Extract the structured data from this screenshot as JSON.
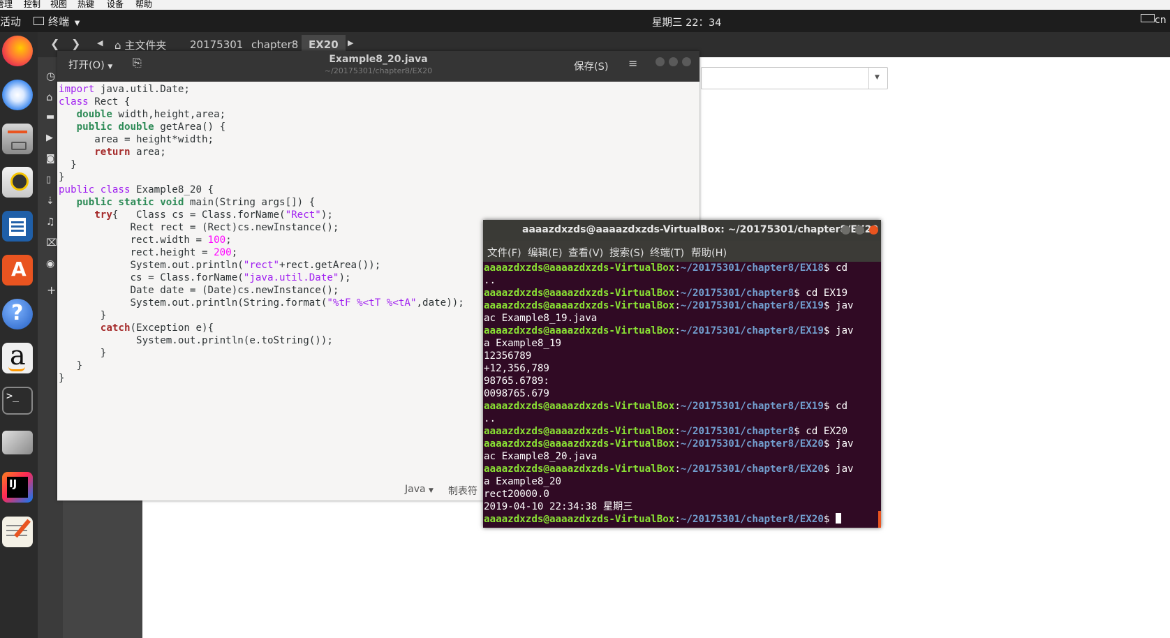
{
  "vbox_menu": [
    "管理",
    "控制",
    "视图",
    "热键",
    "设备",
    "帮助"
  ],
  "topbar": {
    "activities": "活动",
    "app_menu": "终端",
    "clock": "星期三 22：34",
    "input_method": "cn"
  },
  "files": {
    "breadcrumbs": [
      "主文件夹",
      "20175301",
      "chapter8",
      "EX20"
    ]
  },
  "gedit": {
    "open_label": "打开(O)",
    "filename": "Example8_20.java",
    "path": "~/20175301/chapter8/EX20",
    "save_label": "保存(S)",
    "language": "Java",
    "tab_width": "制表符"
  },
  "code_lines": [
    [
      [
        "import",
        "kw-p"
      ],
      [
        " java.util.Date;",
        ""
      ]
    ],
    [
      [
        "class",
        "kw-p"
      ],
      [
        " Rect {",
        ""
      ]
    ],
    [
      [
        "   ",
        ""
      ],
      [
        "double",
        "kw-b"
      ],
      [
        " width,height,area;",
        ""
      ]
    ],
    [
      [
        "   ",
        ""
      ],
      [
        "public",
        "kw-b"
      ],
      [
        " ",
        ""
      ],
      [
        "double",
        "kw-b"
      ],
      [
        " getArea() {",
        ""
      ]
    ],
    [
      [
        "      area = height*width;",
        ""
      ]
    ],
    [
      [
        "      ",
        ""
      ],
      [
        "return",
        "kw-r"
      ],
      [
        " area;",
        ""
      ]
    ],
    [
      [
        "  }",
        ""
      ]
    ],
    [
      [
        "}",
        ""
      ]
    ],
    [
      [
        "public",
        "kw-p"
      ],
      [
        " ",
        ""
      ],
      [
        "class",
        "kw-p"
      ],
      [
        " Example8_20 {",
        ""
      ]
    ],
    [
      [
        "   ",
        ""
      ],
      [
        "public",
        "kw-b"
      ],
      [
        " ",
        ""
      ],
      [
        "static",
        "kw-b"
      ],
      [
        " ",
        ""
      ],
      [
        "void",
        "kw-b"
      ],
      [
        " main(String args[]) {",
        ""
      ]
    ],
    [
      [
        "      ",
        ""
      ],
      [
        "try",
        "kw-r"
      ],
      [
        "{   Class cs = Class.forName(",
        ""
      ],
      [
        "\"Rect\"",
        "str"
      ],
      [
        ");",
        ""
      ]
    ],
    [
      [
        "            Rect rect = (Rect)cs.newInstance();",
        ""
      ]
    ],
    [
      [
        "            rect.width = ",
        ""
      ],
      [
        "100",
        "num"
      ],
      [
        ";",
        ""
      ]
    ],
    [
      [
        "            rect.height = ",
        ""
      ],
      [
        "200",
        "num"
      ],
      [
        ";",
        ""
      ]
    ],
    [
      [
        "            System.out.println(",
        ""
      ],
      [
        "\"rect\"",
        "str"
      ],
      [
        "+rect.getArea());",
        ""
      ]
    ],
    [
      [
        "            cs = Class.forName(",
        ""
      ],
      [
        "\"java.util.Date\"",
        "str"
      ],
      [
        ");",
        ""
      ]
    ],
    [
      [
        "            Date date = (Date)cs.newInstance();",
        ""
      ]
    ],
    [
      [
        "            System.out.println(String.format(",
        ""
      ],
      [
        "\"%tF %<tT %<tA\"",
        "str"
      ],
      [
        ",date));",
        ""
      ]
    ],
    [
      [
        "       }",
        ""
      ]
    ],
    [
      [
        "       ",
        ""
      ],
      [
        "catch",
        "kw-r"
      ],
      [
        "(Exception e){",
        ""
      ]
    ],
    [
      [
        "             System.out.println(e.toString());",
        ""
      ]
    ],
    [
      [
        "       }",
        ""
      ]
    ],
    [
      [
        "   }",
        ""
      ]
    ],
    [
      [
        "}",
        ""
      ]
    ]
  ],
  "terminal": {
    "title": "aaaazdxzds@aaaazdxzds-VirtualBox: ~/20175301/chapter8/EX20",
    "menu": [
      "文件(F)",
      "编辑(E)",
      "查看(V)",
      "搜索(S)",
      "终端(T)",
      "帮助(H)"
    ],
    "lines": [
      [
        [
          "aaaazdxzds@aaaazdxzds-VirtualBox",
          "pu"
        ],
        [
          ":",
          ""
        ],
        [
          "~/20175301/chapter8/EX18",
          "pp"
        ],
        [
          "$ cd",
          ""
        ]
      ],
      [
        [
          "..",
          ""
        ]
      ],
      [
        [
          "aaaazdxzds@aaaazdxzds-VirtualBox",
          "pu"
        ],
        [
          ":",
          ""
        ],
        [
          "~/20175301/chapter8",
          "pp"
        ],
        [
          "$ cd EX19",
          ""
        ]
      ],
      [
        [
          "aaaazdxzds@aaaazdxzds-VirtualBox",
          "pu"
        ],
        [
          ":",
          ""
        ],
        [
          "~/20175301/chapter8/EX19",
          "pp"
        ],
        [
          "$ jav",
          ""
        ]
      ],
      [
        [
          "ac Example8_19.java",
          ""
        ]
      ],
      [
        [
          "aaaazdxzds@aaaazdxzds-VirtualBox",
          "pu"
        ],
        [
          ":",
          ""
        ],
        [
          "~/20175301/chapter8/EX19",
          "pp"
        ],
        [
          "$ jav",
          ""
        ]
      ],
      [
        [
          "a Example8_19",
          ""
        ]
      ],
      [
        [
          "12356789",
          ""
        ]
      ],
      [
        [
          "+12,356,789",
          ""
        ]
      ],
      [
        [
          "98765.6789:",
          ""
        ]
      ],
      [
        [
          "0098765.679",
          ""
        ]
      ],
      [
        [
          "aaaazdxzds@aaaazdxzds-VirtualBox",
          "pu"
        ],
        [
          ":",
          ""
        ],
        [
          "~/20175301/chapter8/EX19",
          "pp"
        ],
        [
          "$ cd",
          ""
        ]
      ],
      [
        [
          "..",
          ""
        ]
      ],
      [
        [
          "aaaazdxzds@aaaazdxzds-VirtualBox",
          "pu"
        ],
        [
          ":",
          ""
        ],
        [
          "~/20175301/chapter8",
          "pp"
        ],
        [
          "$ cd EX20",
          ""
        ]
      ],
      [
        [
          "aaaazdxzds@aaaazdxzds-VirtualBox",
          "pu"
        ],
        [
          ":",
          ""
        ],
        [
          "~/20175301/chapter8/EX20",
          "pp"
        ],
        [
          "$ jav",
          ""
        ]
      ],
      [
        [
          "ac Example8_20.java",
          ""
        ]
      ],
      [
        [
          "aaaazdxzds@aaaazdxzds-VirtualBox",
          "pu"
        ],
        [
          ":",
          ""
        ],
        [
          "~/20175301/chapter8/EX20",
          "pp"
        ],
        [
          "$ jav",
          ""
        ]
      ],
      [
        [
          "a Example8_20",
          ""
        ]
      ],
      [
        [
          "rect20000.0",
          ""
        ]
      ],
      [
        [
          "2019-04-10 22:34:38 星期三",
          ""
        ]
      ],
      [
        [
          "aaaazdxzds@aaaazdxzds-VirtualBox",
          "pu"
        ],
        [
          ":",
          ""
        ],
        [
          "~/20175301/chapter8/EX20",
          "pp"
        ],
        [
          "$ ",
          ""
        ]
      ]
    ]
  },
  "dock_icons": [
    "firefox-icon",
    "thunderbird-icon",
    "files-icon",
    "rhythmbox-icon",
    "writer-icon",
    "software-icon",
    "help-icon",
    "amazon-icon",
    "terminal-icon",
    "scanner-icon",
    "intellij-icon",
    "text-editor-icon"
  ],
  "colors": {
    "terminal_bg": "#300a24",
    "prompt_user": "#8ae234",
    "prompt_path": "#729fcf",
    "ubuntu_orange": "#e95420"
  }
}
